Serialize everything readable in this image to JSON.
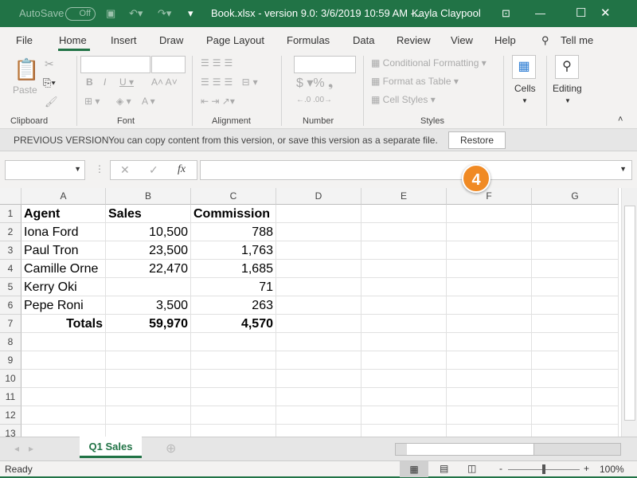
{
  "title_bar": {
    "autosave": "AutoSave",
    "autosave_state": "Off",
    "document": "Book.xlsx  -  version 9.0: 3/6/2019 10:59 AM  -...",
    "user": "Kayla Claypool"
  },
  "menu": [
    "File",
    "Home",
    "Insert",
    "Draw",
    "Page Layout",
    "Formulas",
    "Data",
    "Review",
    "View",
    "Help",
    "Tell me"
  ],
  "ribbon": {
    "paste": "Paste",
    "groups": [
      "Clipboard",
      "Font",
      "Alignment",
      "Number",
      "Styles"
    ],
    "conditional": "Conditional Formatting",
    "format_table": "Format as Table",
    "cell_styles": "Cell Styles",
    "cells": "Cells",
    "editing": "Editing"
  },
  "message_bar": {
    "label": "PREVIOUS VERSION",
    "text": "You can copy content from this version, or save this version as a separate file.",
    "button": "Restore"
  },
  "callout": "4",
  "formula_bar": {
    "fx": "fx",
    "name_box": "",
    "formula": ""
  },
  "columns": [
    "A",
    "B",
    "C",
    "D",
    "E",
    "F",
    "G"
  ],
  "rows": [
    [
      "Agent",
      "Sales",
      "Commission"
    ],
    [
      "Iona Ford",
      "10,500",
      "788"
    ],
    [
      "Paul Tron",
      "23,500",
      "1,763"
    ],
    [
      "Camille Orne",
      "22,470",
      "1,685"
    ],
    [
      "Kerry Oki",
      "",
      "71"
    ],
    [
      "Pepe Roni",
      "3,500",
      "263"
    ],
    [
      "Totals",
      "59,970",
      "4,570"
    ],
    [
      "",
      "",
      ""
    ],
    [
      "",
      "",
      ""
    ],
    [
      "",
      "",
      ""
    ],
    [
      "",
      "",
      ""
    ],
    [
      "",
      "",
      ""
    ],
    [
      "",
      "",
      ""
    ]
  ],
  "sheet_tab": "Q1 Sales",
  "status": {
    "ready": "Ready",
    "zoom": "100%",
    "zoom_percent": 100
  },
  "colors": {
    "accent": "#217346",
    "callout": "#f08a24"
  }
}
